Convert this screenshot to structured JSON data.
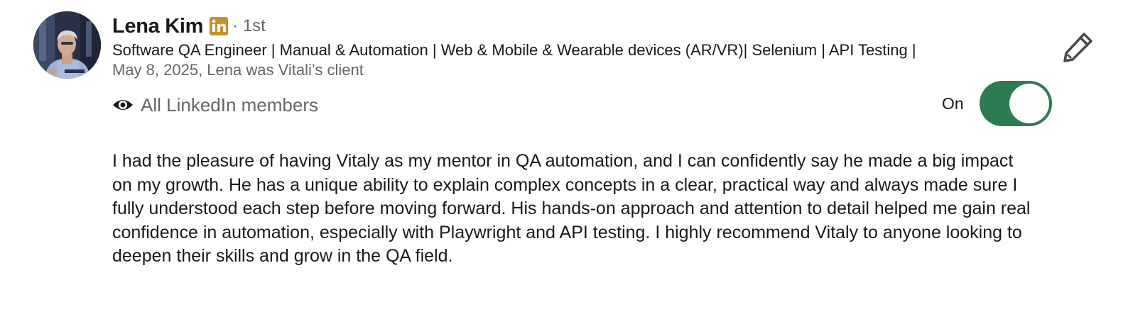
{
  "recommendation": {
    "author": {
      "name": "Lena Kim",
      "degree": "· 1st",
      "headline": "Software QA Engineer | Manual & Automation | Web & Mobile & Wearable devices (AR/VR)| Selenium | API Testing |",
      "meta": "May 8, 2025, Lena was Vitali’s client",
      "avatar_icon": "profile-photo",
      "badge_icon": "linkedin-premium-icon"
    },
    "visibility": {
      "label": "All LinkedIn members",
      "icon": "eye-icon"
    },
    "toggle": {
      "state_label": "On",
      "on": true,
      "color": "#2e7a52"
    },
    "edit_icon": "pencil-icon",
    "text": "I had the pleasure of having Vitaly as my mentor in QA automation, and I can confidently say he made a big impact on my growth. He has a unique ability to explain complex concepts in a clear, practical way and always made sure I fully understood each step before moving forward. His hands-on approach and attention to detail helped me gain real confidence in automation, especially with Playwright and API testing. I highly recommend Vitaly to anyone looking to deepen their skills and grow in the QA field."
  },
  "colors": {
    "badge": "#c5902c",
    "muted_text": "#666666",
    "primary_text": "#191919"
  }
}
